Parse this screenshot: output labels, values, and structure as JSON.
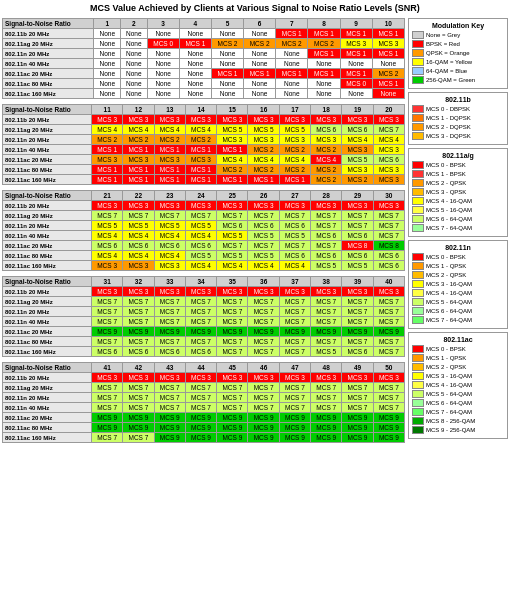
{
  "title": "MCS Value Achieved by Clients at Various Signal to Noise Ratio Levels (SNR)",
  "modulation_key": {
    "title": "Modulation Key",
    "items": [
      {
        "label": "None = Grey",
        "color": "none"
      },
      {
        "label": "BPSK = Red",
        "color": "red"
      },
      {
        "label": "QPSK = Orange",
        "color": "orange"
      },
      {
        "label": "16-QAM = Yellow",
        "color": "yellow"
      },
      {
        "label": "64-QAM = Blue",
        "color": "blue"
      },
      {
        "label": "256-QAM = Green",
        "color": "green"
      }
    ]
  },
  "legend_802_11b": {
    "title": "802.11b",
    "items": [
      {
        "label": "MCS 0 - DBPSK",
        "color": "red"
      },
      {
        "label": "MCS 1 - DQPSK",
        "color": "orange"
      },
      {
        "label": "MCS 2 - DQPSK",
        "color": "orange"
      },
      {
        "label": "MCS 3 - DQPSK",
        "color": "orange"
      }
    ]
  },
  "legend_802_11a": {
    "title": "802.11a/g",
    "items": [
      {
        "label": "MCS 0 - BPSK",
        "color": "red"
      },
      {
        "label": "MCS 1 - BPSK",
        "color": "red"
      },
      {
        "label": "MCS 2 - QPSK",
        "color": "orange"
      },
      {
        "label": "MCS 3 - QPSK",
        "color": "orange"
      },
      {
        "label": "MCS 4 - 16-QAM",
        "color": "yellow"
      },
      {
        "label": "MCS 5 - 16-QAM",
        "color": "yellow"
      },
      {
        "label": "MCS 6 - 64-QAM",
        "color": "lime"
      },
      {
        "label": "MCS 7 - 64-QAM",
        "color": "lime"
      }
    ]
  },
  "legend_802_11n": {
    "title": "802.11n",
    "items": [
      {
        "label": "MCS 0 - BPSK",
        "color": "red"
      },
      {
        "label": "MCS 1 - QPSK",
        "color": "orange"
      },
      {
        "label": "MCS 2 - QPSK",
        "color": "orange"
      },
      {
        "label": "MCS 3 - 16-QAM",
        "color": "yellow"
      },
      {
        "label": "MCS 4 - 16-QAM",
        "color": "yellow"
      },
      {
        "label": "MCS 5 - 64-QAM",
        "color": "lime"
      },
      {
        "label": "MCS 6 - 64-QAM",
        "color": "lime"
      },
      {
        "label": "MCS 7 - 64-QAM",
        "color": "lime"
      }
    ]
  },
  "legend_802_11ac": {
    "title": "802.11ac",
    "items": [
      {
        "label": "MCS 0 - BPSK",
        "color": "red"
      },
      {
        "label": "MCS 1 - QPSK",
        "color": "orange"
      },
      {
        "label": "MCS 2 - QPSK",
        "color": "orange"
      },
      {
        "label": "MCS 3 - 16-QAM",
        "color": "yellow"
      },
      {
        "label": "MCS 4 - 16-QAM",
        "color": "yellow"
      },
      {
        "label": "MCS 5 - 64-QAM",
        "color": "lime"
      },
      {
        "label": "MCS 6 - 64-QAM",
        "color": "lime"
      },
      {
        "label": "MCS 7 - 64-QAM",
        "color": "lime"
      },
      {
        "label": "MCS 8 - 256-QAM",
        "color": "green"
      },
      {
        "label": "MCS 9 - 256-QAM",
        "color": "green"
      }
    ]
  }
}
